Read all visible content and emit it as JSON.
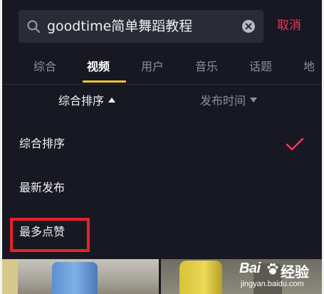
{
  "search": {
    "query": "goodtime简单舞蹈教程",
    "cancel_label": "取消"
  },
  "tabs": [
    {
      "label": "综合",
      "active": false
    },
    {
      "label": "视频",
      "active": true
    },
    {
      "label": "用户",
      "active": false
    },
    {
      "label": "音乐",
      "active": false
    },
    {
      "label": "话题",
      "active": false
    },
    {
      "label": "地",
      "active": false
    }
  ],
  "sort_bar": {
    "comprehensive_label": "综合排序",
    "time_label": "发布时间"
  },
  "sort_menu": {
    "items": [
      {
        "label": "综合排序",
        "selected": true
      },
      {
        "label": "最新发布",
        "selected": false
      },
      {
        "label": "最多点赞",
        "selected": false
      }
    ]
  },
  "watermark": {
    "brand_left": "Bai",
    "brand_right": "经验",
    "url": "jingyan.baidu.com"
  },
  "colors": {
    "background": "#171821",
    "accent_red": "#f1355a",
    "tab_indicator": "#f5c431",
    "highlight_box": "#e8202a"
  },
  "icons": [
    "search-icon",
    "clear-icon",
    "check-icon",
    "paw-icon"
  ]
}
